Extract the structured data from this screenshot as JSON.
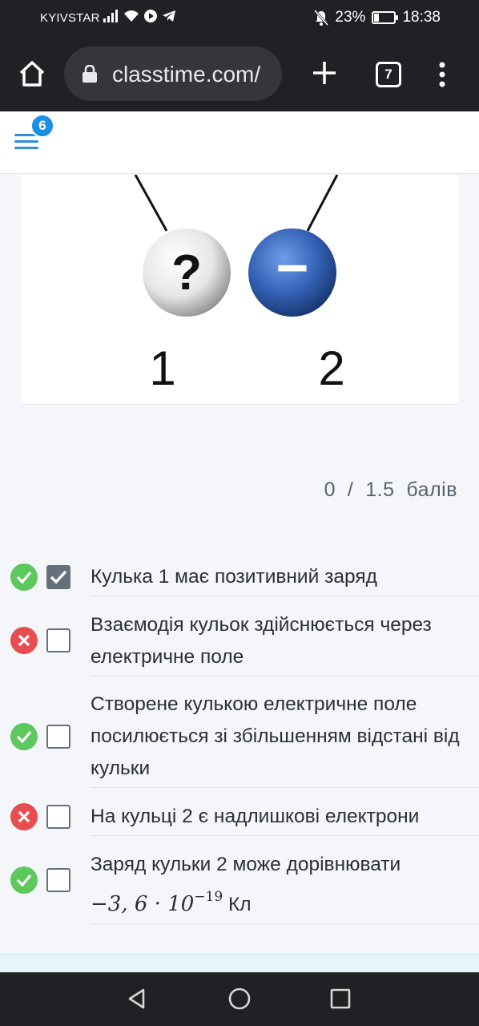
{
  "status_bar": {
    "carrier": "KYIVSTAR",
    "battery": "23%",
    "battery_level": 0.23,
    "time": "18:38"
  },
  "browser": {
    "url": "classtime.com/",
    "tab_count": "7"
  },
  "app": {
    "menu_badge": "6"
  },
  "image": {
    "ball_1_symbol": "?",
    "ball_2_symbol": "−",
    "ball_1_label": "1",
    "ball_2_label": "2"
  },
  "score": {
    "earned": "0",
    "separator": "/",
    "total": "1.5",
    "unit": "балів"
  },
  "answers": [
    {
      "text": "Кулька 1 має позитивний заряд",
      "status": "correct",
      "checked": true
    },
    {
      "text": "Взаємодія кульок здійснюється через електричне поле",
      "status": "wrong",
      "checked": false
    },
    {
      "text": "Створене кулькою електричне поле посилюється зі збільшенням відстані від кульки",
      "status": "correct",
      "checked": false
    },
    {
      "text": "На кульці 2 є надлишкові електрони",
      "status": "wrong",
      "checked": false
    },
    {
      "text": "Заряд кульки 2 може дорівнювати",
      "formula_base": "−3, 6 · 10",
      "formula_exp": "−19",
      "formula_unit": "Кл",
      "status": "correct",
      "checked": false
    }
  ],
  "colors": {
    "correct": "#5cc85e",
    "wrong": "#e84d4f",
    "accent": "#1a8fe3",
    "ball_negative": "#2e5aa8"
  }
}
